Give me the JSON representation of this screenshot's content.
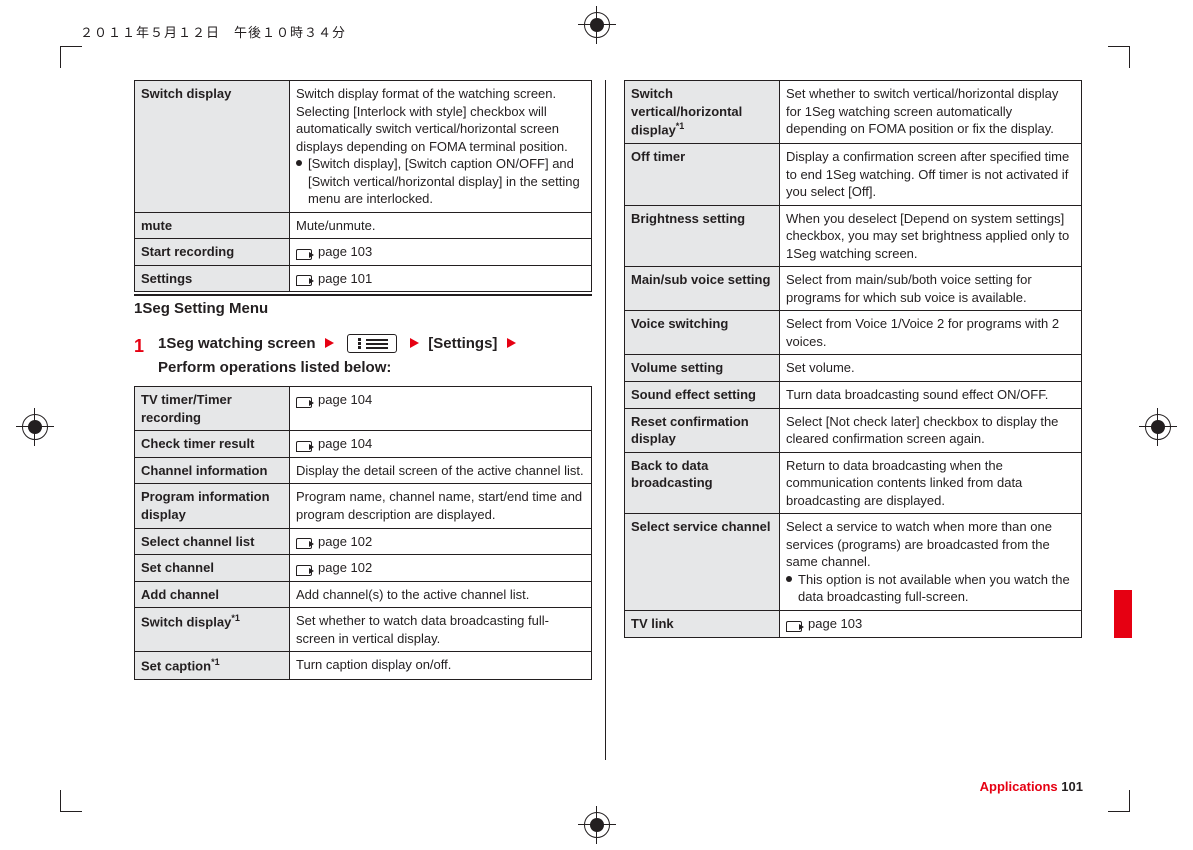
{
  "timestamp": "２０１１年５月１２日　午後１０時３４分",
  "top_table": [
    {
      "key": "Switch display",
      "desc_p1": "Switch display format of the watching screen. Selecting [Interlock with style] checkbox will automatically switch vertical/horizontal screen displays depending on FOMA terminal position.",
      "bullet": "[Switch display], [Switch caption ON/OFF] and [Switch vertical/horizontal display] in the setting menu are interlocked."
    },
    {
      "key": "mute",
      "desc": "Mute/unmute."
    },
    {
      "key": "Start recording",
      "ref": "page 103"
    },
    {
      "key": "Settings",
      "ref": "page 101"
    }
  ],
  "section_title": "1Seg Setting Menu",
  "step": {
    "num": "1",
    "lead": "1Seg watching screen",
    "tail": "[Settings]",
    "line2": "Perform operations listed below:"
  },
  "mid_table": [
    {
      "key": "TV timer/Timer recording",
      "ref": "page 104"
    },
    {
      "key": "Check timer result",
      "ref": "page 104"
    },
    {
      "key": "Channel information",
      "desc": "Display the detail screen of the active channel list."
    },
    {
      "key": "Program information display",
      "desc": "Program name, channel name, start/end time and program description are displayed."
    },
    {
      "key": "Select channel list",
      "ref": "page 102"
    },
    {
      "key": "Set channel",
      "ref": "page 102"
    },
    {
      "key": "Add channel",
      "desc": "Add channel(s) to the active channel list."
    },
    {
      "key": "Switch display",
      "sup": "*1",
      "desc": "Set whether to watch data broadcasting full-screen in vertical display."
    },
    {
      "key": "Set caption",
      "sup": "*1",
      "desc": "Turn caption display on/off."
    }
  ],
  "right_table": [
    {
      "key": "Switch vertical/horizontal display",
      "sup": "*1",
      "desc": "Set whether to switch vertical/horizontal display for 1Seg watching screen automatically depending on FOMA position or fix the display."
    },
    {
      "key": "Off timer",
      "desc": "Display a confirmation screen after specified time to end 1Seg watching. Off timer is not activated if you select [Off]."
    },
    {
      "key": "Brightness setting",
      "desc": "When you deselect [Depend on system settings] checkbox, you may set brightness applied only to 1Seg watching screen."
    },
    {
      "key": "Main/sub voice setting",
      "desc": "Select from main/sub/both voice setting for programs for which sub voice is available."
    },
    {
      "key": "Voice switching",
      "desc": "Select from Voice 1/Voice 2 for programs with 2 voices."
    },
    {
      "key": "Volume setting",
      "desc": "Set volume."
    },
    {
      "key": "Sound effect setting",
      "desc": "Turn data broadcasting sound effect ON/OFF."
    },
    {
      "key": "Reset confirmation display",
      "desc": "Select [Not check later] checkbox to display the cleared confirmation screen again."
    },
    {
      "key": "Back to data broadcasting",
      "desc": "Return to data broadcasting when the communication contents linked from data broadcasting are displayed."
    },
    {
      "key": "Select service channel",
      "desc_p1": "Select a service to watch when more than one services (programs) are broadcasted from the same channel.",
      "bullet": "This option is not available when you watch the data broadcasting full-screen."
    },
    {
      "key": "TV link",
      "ref": "page 103"
    }
  ],
  "footer_section": "Applications",
  "footer_page": "101"
}
